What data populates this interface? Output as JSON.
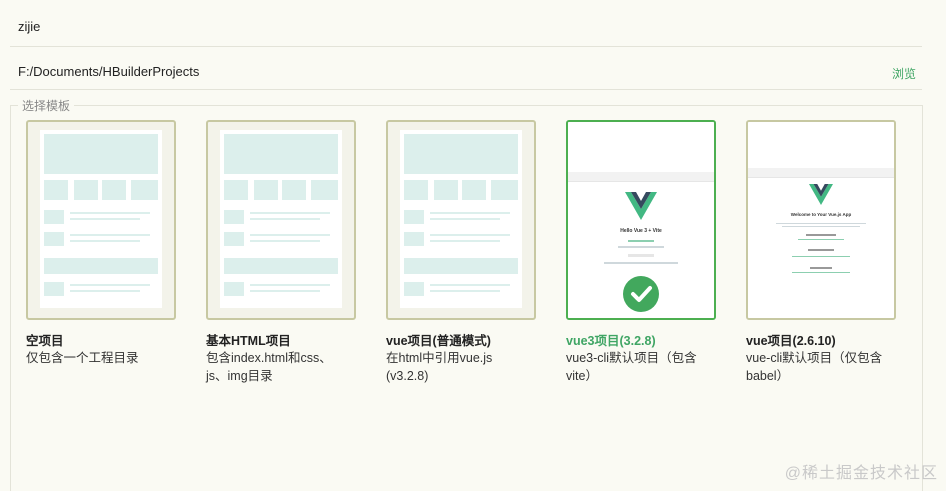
{
  "form": {
    "name_value": "zijie",
    "path_value": "F:/Documents/HBuilderProjects",
    "browse_label": "浏览",
    "section_label": "选择模板"
  },
  "templates": [
    {
      "title": "空项目",
      "desc": "仅包含一个工程目录",
      "selected": false,
      "thumb": "wireframe"
    },
    {
      "title": "基本HTML项目",
      "desc": "包含index.html和css、js、img目录",
      "selected": false,
      "thumb": "wireframe"
    },
    {
      "title": "vue项目(普通模式)",
      "desc": "在html中引用vue.js (v3.2.8)",
      "selected": false,
      "thumb": "wireframe"
    },
    {
      "title": "vue3项目(3.2.8)",
      "desc": "vue3-cli默认项目（包含vite）",
      "selected": true,
      "thumb": "vue3"
    },
    {
      "title": "vue项目(2.6.10)",
      "desc": "vue-cli默认项目（仅包含babel）",
      "selected": false,
      "thumb": "vue2"
    }
  ],
  "thumb_text": {
    "vue3_heading": "Hello Vue 3 + Vite",
    "vue2_heading": "Welcome to Your Vue.js App"
  },
  "watermark": "@稀土掘金技术社区",
  "colors": {
    "accent": "#3fa564",
    "selected_border": "#4caf50",
    "card_border": "#c7c8a2"
  },
  "icons": {
    "selected_mark": "check-circle-icon",
    "vue_logo": "vue-logo-icon"
  }
}
